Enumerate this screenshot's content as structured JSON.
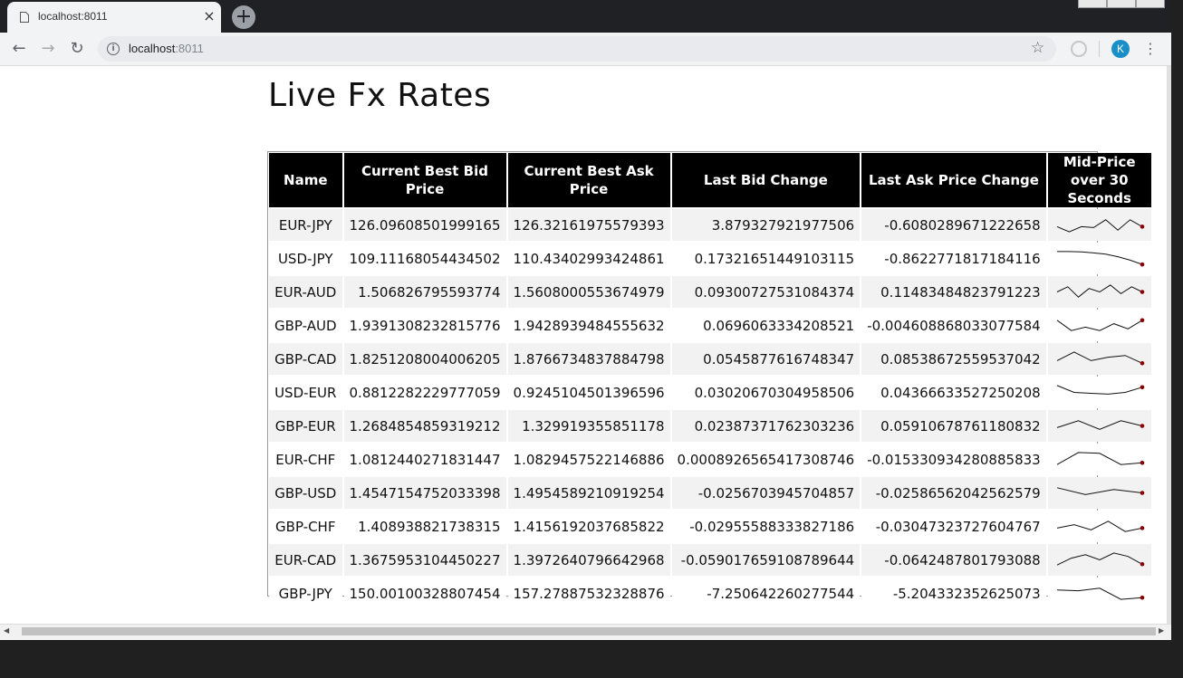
{
  "browser": {
    "tab_title": "localhost:8011",
    "tab_close": "×",
    "new_tab": "+",
    "url_host": "localhost",
    "url_port": ":8011",
    "avatar_letter": "K",
    "back": "←",
    "forward": "→",
    "reload": "↻",
    "star": "☆",
    "menu": "⋮",
    "info": "i"
  },
  "page": {
    "title": "Live Fx Rates"
  },
  "table": {
    "headers": [
      "Name",
      "Current Best Bid Price",
      "Current Best Ask Price",
      "Last Bid Change",
      "Last Ask Price Change",
      "Mid-Price over 30 Seconds"
    ],
    "rows": [
      {
        "name": "EUR-JPY",
        "bid": "126.09608501999165",
        "ask": "126.32161975579393",
        "bid_change": "3.879327921977506",
        "ask_change": "-0.6080289671222658",
        "spark": [
          0.6,
          0.9,
          0.6,
          0.65,
          0.2,
          0.8,
          0.2,
          0.6
        ]
      },
      {
        "name": "USD-JPY",
        "bid": "109.11168054434502",
        "ask": "110.43402993424861",
        "bid_change": "0.17321651449103115",
        "ask_change": "-0.8622771817184116",
        "spark": [
          0.1,
          0.1,
          0.12,
          0.18,
          0.25,
          0.4,
          0.6,
          0.85
        ]
      },
      {
        "name": "EUR-AUD",
        "bid": "1.506826795593774",
        "ask": "1.5608000553674979",
        "bid_change": "0.09300727531084374",
        "ask_change": "0.11483484823791223",
        "spark": [
          0.5,
          0.2,
          0.8,
          0.3,
          0.5,
          0.1,
          0.6,
          0.2,
          0.5
        ]
      },
      {
        "name": "GBP-AUD",
        "bid": "1.9391308232815776",
        "ask": "1.9428939484555632",
        "bid_change": "0.0696063334208521",
        "ask_change": "-0.004608868033077584",
        "spark": [
          0.2,
          0.8,
          0.6,
          0.8,
          0.4,
          0.7,
          0.2
        ]
      },
      {
        "name": "GBP-CAD",
        "bid": "1.8251208004006205",
        "ask": "1.8766734837884798",
        "bid_change": "0.0545877616748347",
        "ask_change": "0.08538672559537042",
        "spark": [
          0.6,
          0.1,
          0.6,
          0.4,
          0.3,
          0.75
        ]
      },
      {
        "name": "USD-EUR",
        "bid": "0.8812282229777059",
        "ask": "0.9245104501396596",
        "bid_change": "0.03020670304958506",
        "ask_change": "0.04366633527250208",
        "spark": [
          0.1,
          0.5,
          0.55,
          0.6,
          0.5,
          0.2
        ]
      },
      {
        "name": "GBP-EUR",
        "bid": "1.2684854859319212",
        "ask": "1.329919355851178",
        "bid_change": "0.02387371762303236",
        "ask_change": "0.05910678761180832",
        "spark": [
          0.6,
          0.2,
          0.7,
          0.2,
          0.5
        ]
      },
      {
        "name": "EUR-CHF",
        "bid": "1.0812440271831447",
        "ask": "1.0829457522146886",
        "bid_change": "0.0008926565417308746",
        "ask_change": "-0.015330934280885833",
        "spark": [
          0.8,
          0.1,
          0.15,
          0.8,
          0.7
        ]
      },
      {
        "name": "GBP-USD",
        "bid": "1.4547154752033398",
        "ask": "1.4954589210919254",
        "bid_change": "-0.0256703945704857",
        "ask_change": "-0.02586562042562579",
        "spark": [
          0.2,
          0.6,
          0.3,
          0.5
        ]
      },
      {
        "name": "GBP-CHF",
        "bid": "1.408938821738315",
        "ask": "1.4156192037685822",
        "bid_change": "-0.02955588333827186",
        "ask_change": "-0.03047323727604767",
        "spark": [
          0.6,
          0.4,
          0.7,
          0.2,
          0.8,
          0.6
        ]
      },
      {
        "name": "EUR-CAD",
        "bid": "1.3675953104450227",
        "ask": "1.3972640796642968",
        "bid_change": "-0.059017659108789644",
        "ask_change": "-0.0642487801793088",
        "spark": [
          0.8,
          0.4,
          0.2,
          0.5,
          0.1,
          0.3,
          0.75
        ]
      },
      {
        "name": "GBP-JPY",
        "bid": "150.00100328807454",
        "ask": "157.27887532328876",
        "bid_change": "-7.250642260277544",
        "ask_change": "-5.204332352625073",
        "spark": [
          0.3,
          0.35,
          0.2,
          0.85,
          0.75
        ]
      }
    ]
  },
  "colors": {
    "header_bg": "#000000",
    "spark_line": "#111111",
    "spark_dot": "#8b0000",
    "row_alt": "#f2f2f2"
  }
}
